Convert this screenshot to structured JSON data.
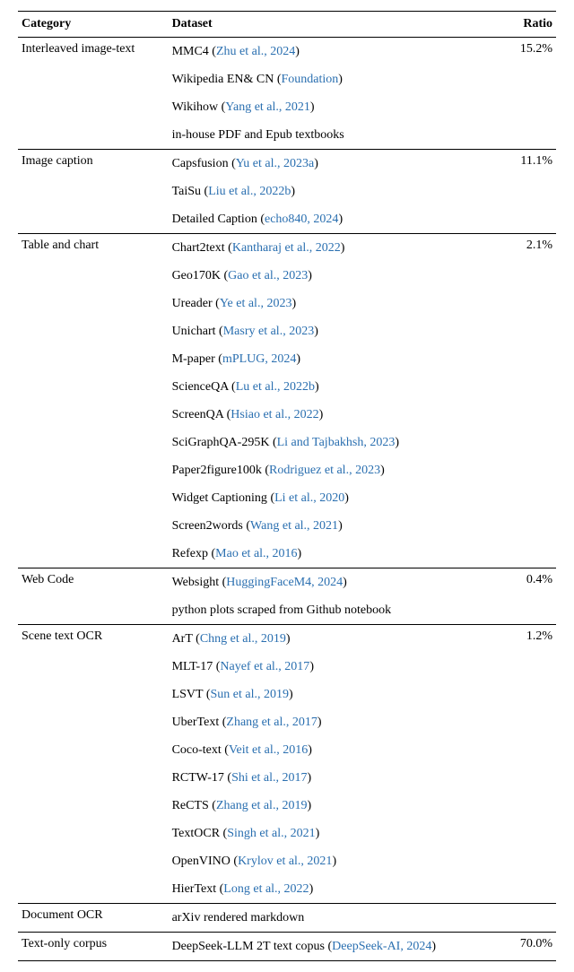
{
  "headers": {
    "category": "Category",
    "dataset": "Dataset",
    "ratio": "Ratio"
  },
  "rows": [
    {
      "category": "Interleaved image-text",
      "ratio": "15.2%",
      "datasets": [
        {
          "name": "MMC4",
          "cite": "Zhu et al., 2024"
        },
        {
          "name": "Wikipedia EN& CN",
          "cite": "Foundation"
        },
        {
          "name": "Wikihow",
          "cite": "Yang et al., 2021"
        },
        {
          "name": "in-house PDF and Epub textbooks",
          "cite": null
        }
      ]
    },
    {
      "category": "Image caption",
      "ratio": "11.1%",
      "datasets": [
        {
          "name": "Capsfusion",
          "cite": "Yu et al., 2023a"
        },
        {
          "name": "TaiSu",
          "cite": "Liu et al., 2022b"
        },
        {
          "name": "Detailed Caption",
          "cite": "echo840, 2024"
        }
      ]
    },
    {
      "category": "Table and chart",
      "ratio": "2.1%",
      "datasets": [
        {
          "name": "Chart2text",
          "cite": "Kantharaj et al., 2022"
        },
        {
          "name": "Geo170K",
          "cite": "Gao et al., 2023"
        },
        {
          "name": "Ureader",
          "cite": "Ye et al., 2023"
        },
        {
          "name": "Unichart",
          "cite": "Masry et al., 2023"
        },
        {
          "name": "M-paper",
          "cite": "mPLUG, 2024"
        },
        {
          "name": "ScienceQA",
          "cite": "Lu et al., 2022b"
        },
        {
          "name": "ScreenQA",
          "cite": "Hsiao et al., 2022"
        },
        {
          "name": "SciGraphQA-295K",
          "cite": "Li and Tajbakhsh, 2023"
        },
        {
          "name": "Paper2figure100k",
          "cite": "Rodriguez et al., 2023"
        },
        {
          "name": "Widget Captioning",
          "cite": "Li et al., 2020"
        },
        {
          "name": "Screen2words",
          "cite": "Wang et al., 2021"
        },
        {
          "name": "Refexp",
          "cite": "Mao et al., 2016"
        }
      ]
    },
    {
      "category": "Web Code",
      "ratio": "0.4%",
      "datasets": [
        {
          "name": "Websight",
          "cite": "HuggingFaceM4, 2024"
        },
        {
          "name": "python plots scraped from Github notebook",
          "cite": null
        }
      ]
    },
    {
      "category": "Scene text OCR",
      "ratio": "1.2%",
      "datasets": [
        {
          "name": "ArT",
          "cite": "Chng et al., 2019"
        },
        {
          "name": "MLT-17",
          "cite": "Nayef et al., 2017"
        },
        {
          "name": "LSVT",
          "cite": "Sun et al., 2019"
        },
        {
          "name": "UberText",
          "cite": "Zhang et al., 2017"
        },
        {
          "name": "Coco-text",
          "cite": "Veit et al., 2016"
        },
        {
          "name": "RCTW-17",
          "cite": "Shi et al., 2017"
        },
        {
          "name": "ReCTS",
          "cite": "Zhang et al., 2019"
        },
        {
          "name": "TextOCR",
          "cite": "Singh et al., 2021"
        },
        {
          "name": "OpenVINO",
          "cite": "Krylov et al., 2021"
        },
        {
          "name": "HierText",
          "cite": "Long et al., 2022"
        }
      ]
    },
    {
      "category": "Document OCR",
      "ratio": "",
      "datasets": [
        {
          "name": "arXiv rendered markdown",
          "cite": null
        }
      ]
    },
    {
      "category": "Text-only corpus",
      "ratio": "70.0%",
      "datasets": [
        {
          "name": "DeepSeek-LLM 2T text copus",
          "cite": "DeepSeek-AI, 2024"
        }
      ]
    }
  ]
}
